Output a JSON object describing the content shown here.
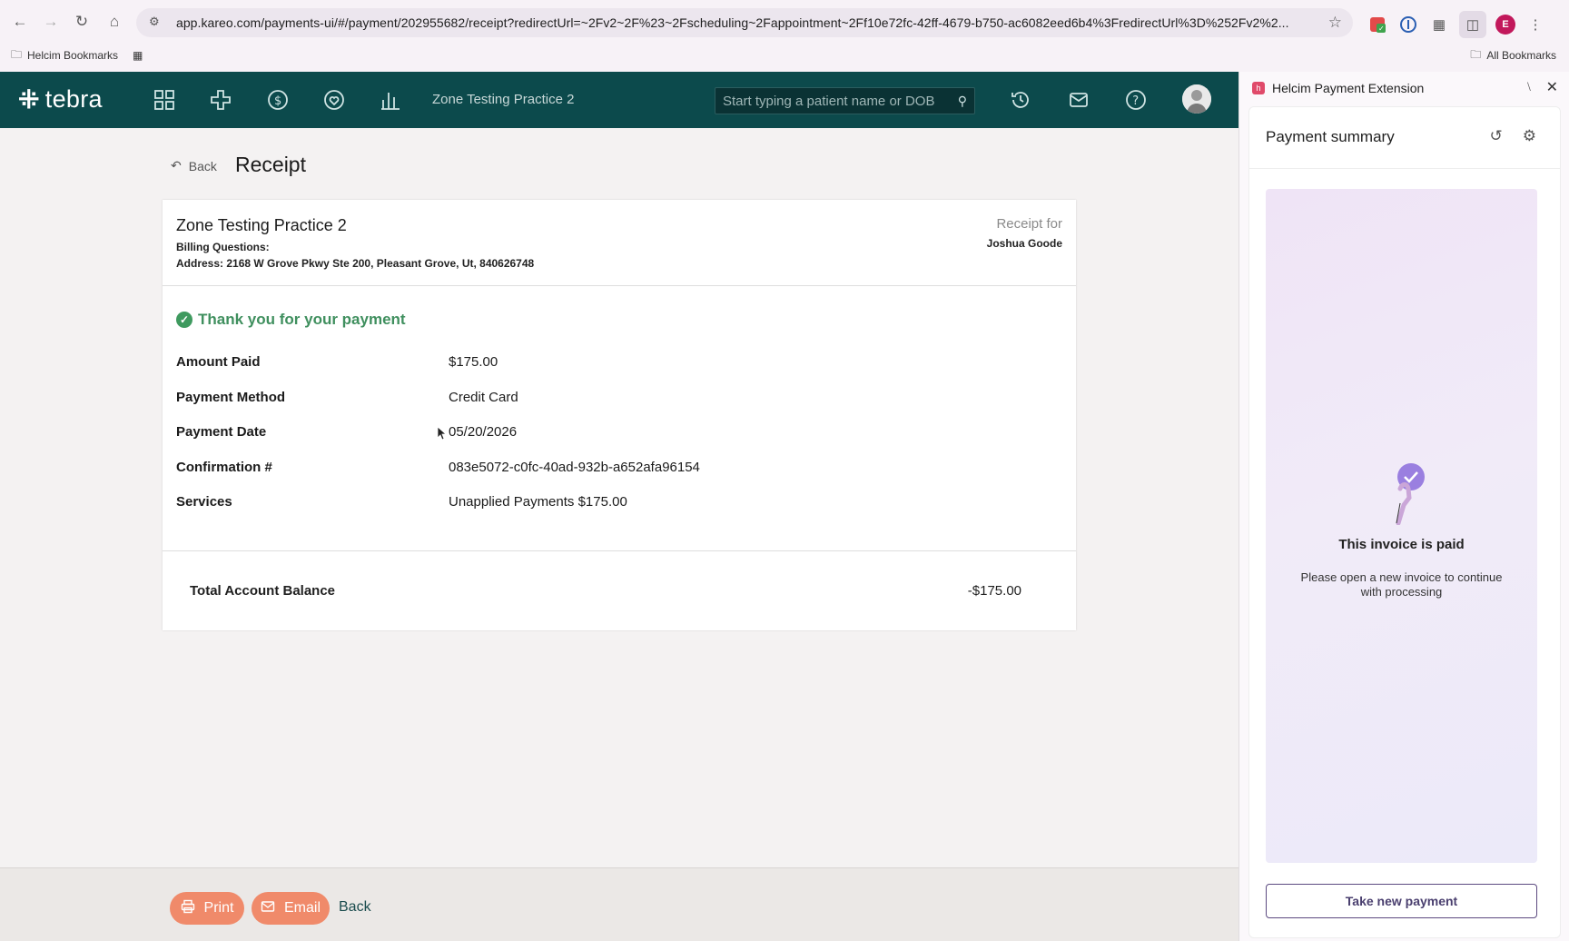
{
  "browser": {
    "url": "app.kareo.com/payments-ui/#/payment/202955682/receipt?redirectUrl=~2Fv2~2F%23~2Fscheduling~2Fappointment~2Ff10e72fc-42ff-4679-b750-ac6082eed6b4%3FredirectUrl%3D%252Fv2%2...",
    "profile_initial": "E",
    "bookmark_folder": "Helcim Bookmarks",
    "all_bookmarks": "All Bookmarks"
  },
  "app": {
    "logo_text": "tebra",
    "practice_name": "Zone Testing Practice 2",
    "search_placeholder": "Start typing a patient name or DOB"
  },
  "page": {
    "back_label": "Back",
    "title": "Receipt"
  },
  "receipt": {
    "practice_name": "Zone Testing Practice 2",
    "billing_questions": "Billing Questions:",
    "address": "Address: 2168 W Grove Pkwy Ste 200, Pleasant Grove, Ut, 840626748",
    "receipt_for_label": "Receipt for",
    "patient_name": "Joshua Goode",
    "thank_you": "Thank you for your payment",
    "rows": [
      {
        "label": "Amount Paid",
        "value": "$175.00"
      },
      {
        "label": "Payment Method",
        "value": "Credit Card"
      },
      {
        "label": "Payment Date",
        "value": "05/20/2026"
      },
      {
        "label": "Confirmation #",
        "value": "083e5072-c0fc-40ad-932b-a652afa96154"
      },
      {
        "label": "Services",
        "value": "Unapplied Payments $175.00"
      }
    ],
    "total_label": "Total Account Balance",
    "total_value": "-$175.00"
  },
  "footer": {
    "print_label": "Print",
    "email_label": "Email",
    "back_label": "Back"
  },
  "extension": {
    "title": "Helcim Payment Extension",
    "panel_title": "Payment summary",
    "paid_title": "This invoice is paid",
    "paid_subtitle": "Please open a new invoice to continue with processing",
    "new_payment_label": "Take new payment"
  },
  "colors": {
    "appbar": "#0c4a4c",
    "accent_button": "#f08a6a",
    "success": "#3f8f5e"
  }
}
